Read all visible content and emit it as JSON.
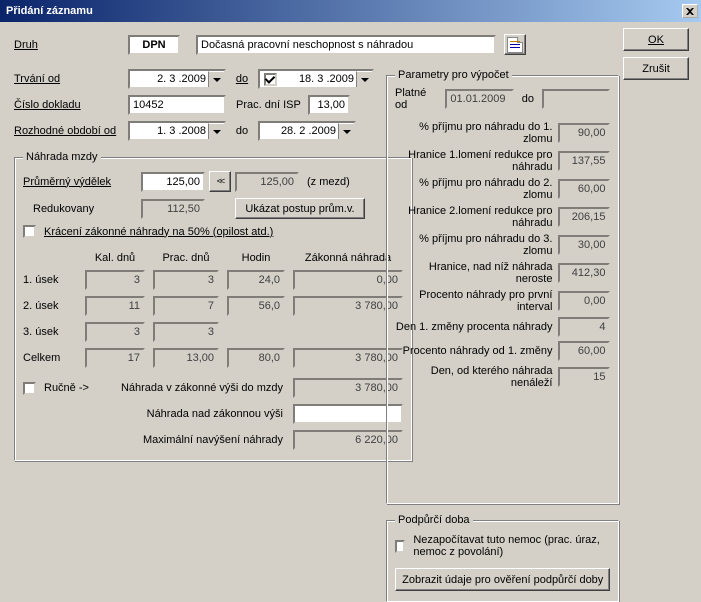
{
  "title": "Přidání záznamu",
  "buttons": {
    "ok": "OK",
    "cancel": "Zrušit"
  },
  "druh": {
    "label": "Druh",
    "code": "DPN",
    "desc": "Dočasná pracovní neschopnost s náhradou"
  },
  "form": {
    "trvani_od_label": "Trvání od",
    "trvani_od": "2. 3 .2009",
    "do_label": "do",
    "trvani_do": "18. 3 .2009",
    "cislo_dokladu_label": "Číslo dokladu",
    "cislo_dokladu": "10452",
    "prac_dni_isp_label": "Prac. dní ISP",
    "prac_dni_isp": "13,00",
    "rozhodne_label": "Rozhodné období od",
    "rozhodne_od": "1. 3 .2008",
    "rozhodne_do": "28. 2 .2009"
  },
  "nahrada": {
    "legend": "Náhrada mzdy",
    "prumerny_label": "Průměrný výdělek",
    "prumerny": "125,00",
    "prumerny_b": "125,00",
    "z_mezd": "(z mezd)",
    "redukovany_label": "Redukovany",
    "redukovany": "112,50",
    "ukazat": "Ukázat postup prům.v.",
    "kraceni": "Krácení zákonné náhrady na 50% (opilost atd.)",
    "hdr_kal": "Kal. dnů",
    "hdr_prac": "Prac. dnů",
    "hdr_hod": "Hodin",
    "hdr_zak": "Zákonná náhrada",
    "r1": {
      "name": "1. úsek",
      "kal": "3",
      "prac": "3",
      "hod": "24,0",
      "zak": "0,00"
    },
    "r2": {
      "name": "2. úsek",
      "kal": "11",
      "prac": "7",
      "hod": "56,0",
      "zak": "3 780,00"
    },
    "r3": {
      "name": "3. úsek",
      "kal": "3",
      "prac": "3",
      "hod": "",
      "zak": ""
    },
    "celkem": {
      "name": "Celkem",
      "kal": "17",
      "prac": "13,00",
      "hod": "80,0",
      "zak": "3 780,00"
    },
    "rucne": "Ručně ->",
    "rucne_label": "Náhrada v zákonné výši do mzdy",
    "rucne_val": "3 780,00",
    "nad_label": "Náhrada nad zákonnou výši",
    "nad_val": "",
    "max_label": "Maximální navýšení náhrady",
    "max_val": "6 220,00"
  },
  "params": {
    "legend": "Parametry pro výpočet",
    "platne_od_label": "Platné od",
    "platne_od": "01.01.2009",
    "platne_do_label": "do",
    "platne_do": "",
    "rows": [
      {
        "label": "% příjmu pro náhradu do 1. zlomu",
        "val": "90,00"
      },
      {
        "label": "Hranice 1.lomení redukce pro náhradu",
        "val": "137,55"
      },
      {
        "label": "% příjmu pro náhradu do 2. zlomu",
        "val": "60,00"
      },
      {
        "label": "Hranice 2.lomení redukce pro náhradu",
        "val": "206,15"
      },
      {
        "label": "% příjmu pro náhradu do 3. zlomu",
        "val": "30,00"
      },
      {
        "label": "Hranice, nad níž náhrada neroste",
        "val": "412,30"
      },
      {
        "label": "Procento náhrady pro první interval",
        "val": "0,00"
      },
      {
        "label": "Den 1. změny procenta náhrady",
        "val": "4"
      },
      {
        "label": "Procento náhrady od 1. změny",
        "val": "60,00"
      },
      {
        "label": "Den, od kterého náhrada nenáleží",
        "val": "15"
      }
    ]
  },
  "podpurci": {
    "legend": "Podpůrčí doba",
    "nezapocitavat": "Nezapočítavat tuto nemoc (prac. úraz, nemoc z povolání)",
    "zobrazit": "Zobrazit údaje pro ověření podpůrčí doby"
  },
  "chart_data": {
    "type": "table",
    "note": "no chart"
  }
}
